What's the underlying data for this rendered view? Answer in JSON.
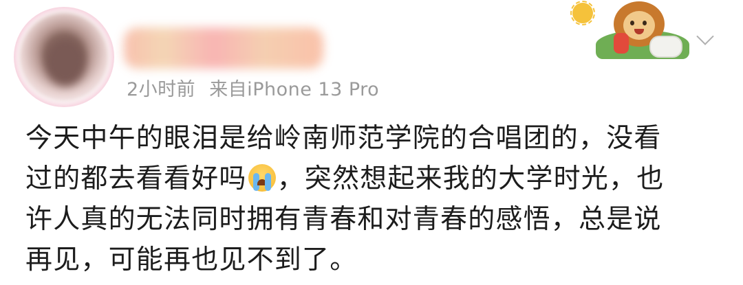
{
  "post": {
    "meta": {
      "time": "2小时前",
      "source": "来自iPhone 13 Pro"
    },
    "text_lines": [
      [
        "今天中午的眼泪是给岭南师范学院的合唱团的，没看"
      ],
      [
        "过的都去看看好吗",
        "，突然想起来我的大学时光，也"
      ],
      [
        "许人真的无法同时拥有青春和对青春的感悟，总是说"
      ],
      [
        "再见，可能再也见不到了。"
      ]
    ],
    "emoji": "crying-face-icon",
    "decoration": "lion-sticker-decoration",
    "menu_icon": "chevron-down-icon"
  }
}
